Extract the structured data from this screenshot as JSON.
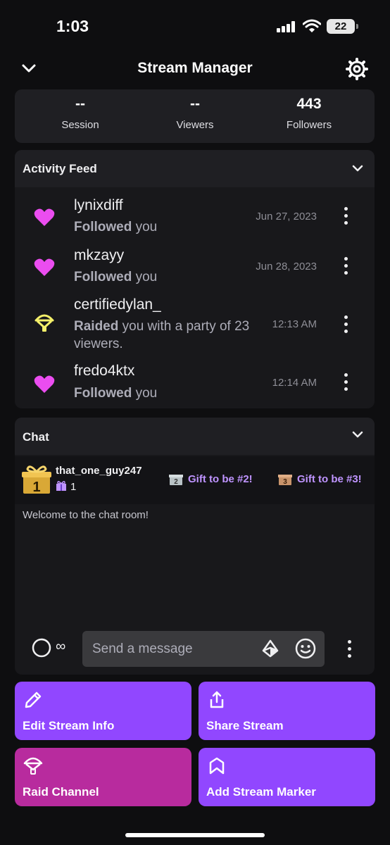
{
  "status_bar": {
    "time": "1:03",
    "battery": "22"
  },
  "header": {
    "title": "Stream Manager"
  },
  "stats": [
    {
      "value": "--",
      "label": "Session"
    },
    {
      "value": "--",
      "label": "Viewers"
    },
    {
      "value": "443",
      "label": "Followers"
    }
  ],
  "activity_feed": {
    "title": "Activity Feed",
    "items": [
      {
        "user": "lynixdiff",
        "action": "Followed",
        "rest": " you",
        "time": "Jun 27, 2023",
        "icon": "heart-icon"
      },
      {
        "user": "mkzayy",
        "action": "Followed",
        "rest": " you",
        "time": "Jun 28, 2023",
        "icon": "heart-icon"
      },
      {
        "user": "certifiedylan_",
        "action": "Raided",
        "rest": " you with a party of 23 viewers.",
        "time": "12:13 AM",
        "icon": "raid-icon"
      },
      {
        "user": "fredo4ktx",
        "action": "Followed",
        "rest": " you",
        "time": "12:14 AM",
        "icon": "heart-icon"
      }
    ]
  },
  "chat": {
    "title": "Chat",
    "leaderboard": {
      "top_user": "that_one_guy247",
      "top_count": "1",
      "slot2": "Gift to be #2!",
      "slot3": "Gift to be #3!"
    },
    "welcome": "Welcome to the chat room!",
    "slowmode_value": "∞",
    "input_placeholder": "Send a message"
  },
  "actions": [
    {
      "label": "Edit Stream Info",
      "color": "#9147ff",
      "icon": "pencil-icon"
    },
    {
      "label": "Share Stream",
      "color": "#9147ff",
      "icon": "share-icon"
    },
    {
      "label": "Raid Channel",
      "color": "#b82b9e",
      "icon": "raid-icon"
    },
    {
      "label": "Add Stream Marker",
      "color": "#9147ff",
      "icon": "bookmark-icon"
    }
  ],
  "colors": {
    "accent": "#9147ff",
    "raid_button": "#b82b9e",
    "heart": "#eb4df0",
    "raid": "#f5f06a",
    "gift_text": "#bf94ff"
  }
}
